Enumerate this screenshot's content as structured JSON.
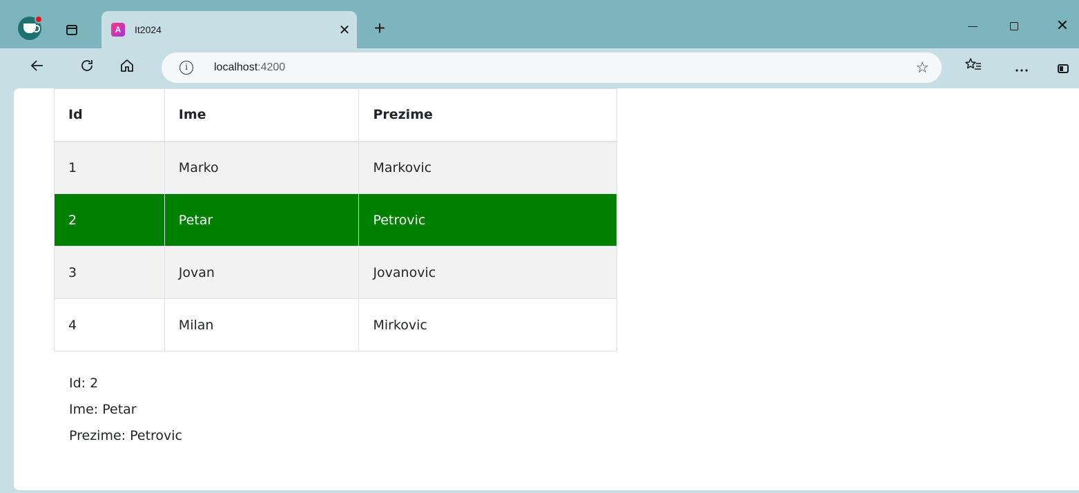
{
  "browser": {
    "tab": {
      "title": "It2024",
      "favicon_letter": "A"
    },
    "new_tab_symbol": "+",
    "address": {
      "host": "localhost",
      "port": ":4200"
    },
    "window_controls": {
      "close_symbol": "✕"
    }
  },
  "table": {
    "headers": [
      "Id",
      "Ime",
      "Prezime"
    ],
    "rows": [
      {
        "id": "1",
        "ime": "Marko",
        "prezime": "Markovic",
        "selected": false
      },
      {
        "id": "2",
        "ime": "Petar",
        "prezime": "Petrovic",
        "selected": true
      },
      {
        "id": "3",
        "ime": "Jovan",
        "prezime": "Jovanovic",
        "selected": false
      },
      {
        "id": "4",
        "ime": "Milan",
        "prezime": "Mirkovic",
        "selected": false
      }
    ]
  },
  "details": {
    "id_line": "Id: 2",
    "ime_line": "Ime: Petar",
    "prezime_line": "Prezime: Petrovic"
  },
  "colors": {
    "selected_row": "#008000",
    "striped_row": "#f2f2f2",
    "browser_frame": "#7eb5bd"
  }
}
